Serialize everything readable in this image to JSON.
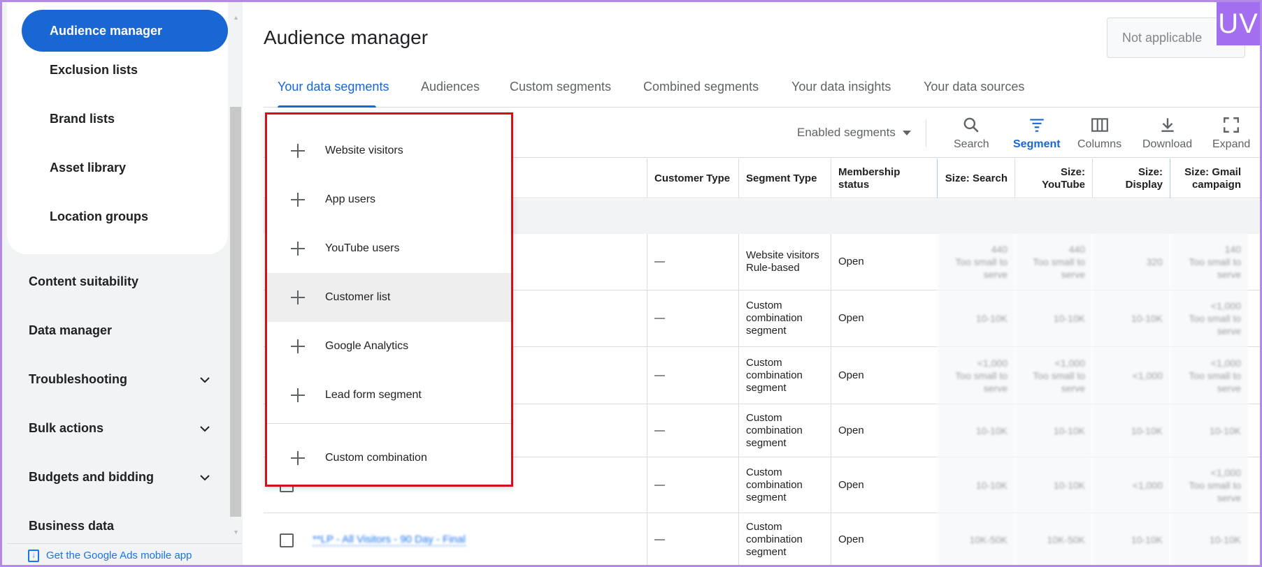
{
  "sidebar": {
    "active_item": "Audience manager",
    "sub_items": [
      "Exclusion lists",
      "Brand lists",
      "Asset library",
      "Location groups"
    ],
    "main_items": [
      {
        "label": "Content suitability",
        "expandable": false
      },
      {
        "label": "Data manager",
        "expandable": false
      },
      {
        "label": "Troubleshooting",
        "expandable": true
      },
      {
        "label": "Bulk actions",
        "expandable": true
      },
      {
        "label": "Budgets and bidding",
        "expandable": true
      },
      {
        "label": "Business data",
        "expandable": false
      }
    ],
    "mobile_app_link": "Get the Google Ads mobile app"
  },
  "header": {
    "title": "Audience manager",
    "account_status": "Not applicable",
    "logo_text": "UV"
  },
  "tabs": [
    {
      "label": "Your data segments",
      "active": true
    },
    {
      "label": "Audiences",
      "active": false
    },
    {
      "label": "Custom segments",
      "active": false
    },
    {
      "label": "Combined segments",
      "active": false
    },
    {
      "label": "Your data insights",
      "active": false
    },
    {
      "label": "Your data sources",
      "active": false
    }
  ],
  "toolbar": {
    "filter_label": "Enabled segments",
    "buttons": [
      {
        "label": "Search",
        "icon": "search-icon",
        "active": false
      },
      {
        "label": "Segment",
        "icon": "segment-icon",
        "active": true
      },
      {
        "label": "Columns",
        "icon": "columns-icon",
        "active": false
      },
      {
        "label": "Download",
        "icon": "download-icon",
        "active": false
      },
      {
        "label": "Expand",
        "icon": "expand-icon",
        "active": false
      }
    ]
  },
  "table": {
    "columns": [
      "Customer Type",
      "Segment Type",
      "Membership status",
      "Size: Search",
      "Size: YouTube",
      "Size: Display",
      "Size: Gmail campaign"
    ],
    "rows": [
      {
        "name": "",
        "customer_type": "—",
        "segment_type": "Website visitors Rule-based",
        "status": "Open",
        "sizes": [
          [
            "440",
            "Too small to serve"
          ],
          [
            "440",
            "Too small to serve"
          ],
          [
            "320"
          ],
          [
            "140",
            "Too small to serve"
          ]
        ]
      },
      {
        "name": "",
        "customer_type": "—",
        "segment_type": "Custom combination segment",
        "status": "Open",
        "sizes": [
          [
            "10-10K"
          ],
          [
            "10-10K"
          ],
          [
            "10-10K"
          ],
          [
            "<1,000",
            "Too small to serve"
          ]
        ]
      },
      {
        "name": "",
        "customer_type": "—",
        "segment_type": "Custom combination segment",
        "status": "Open",
        "sizes": [
          [
            "<1,000",
            "Too small to serve"
          ],
          [
            "<1,000",
            "Too small to serve"
          ],
          [
            "<1,000"
          ],
          [
            "<1,000",
            "Too small to serve"
          ]
        ]
      },
      {
        "name": "",
        "customer_type": "—",
        "segment_type": "Custom combination segment",
        "status": "Open",
        "sizes": [
          [
            "10-10K"
          ],
          [
            "10-10K"
          ],
          [
            "10-10K"
          ],
          [
            "10-10K"
          ]
        ]
      },
      {
        "name": "",
        "customer_type": "—",
        "segment_type": "Custom combination segment",
        "status": "Open",
        "sizes": [
          [
            "10-10K"
          ],
          [
            "10-10K"
          ],
          [
            "<1,000"
          ],
          [
            "<1,000",
            "Too small to serve"
          ]
        ]
      },
      {
        "name": "**LP - All Visitors - 90 Day - Final",
        "customer_type": "—",
        "segment_type": "Custom combination segment",
        "status": "Open",
        "sizes": [
          [
            "10K-50K"
          ],
          [
            "10K-50K"
          ],
          [
            "10-10K"
          ],
          [
            "10-10K"
          ]
        ]
      }
    ]
  },
  "segment_menu": {
    "items": [
      "Website visitors",
      "App users",
      "YouTube users",
      "Customer list",
      "Google Analytics",
      "Lead form segment"
    ],
    "highlighted": "Customer list",
    "footer_item": "Custom combination"
  }
}
